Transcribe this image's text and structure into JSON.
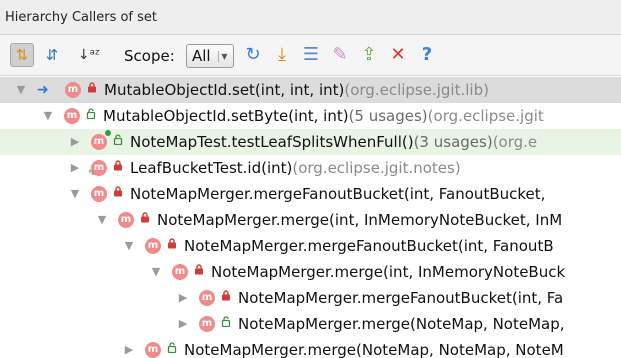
{
  "window": {
    "title": "Hierarchy Callers of set"
  },
  "toolbar": {
    "scope_label": "Scope:",
    "scope_value": "All",
    "buttons": [
      {
        "name": "caller-hierarchy-button",
        "icon": "caller-hierarchy-icon",
        "glyph": "⇅",
        "color": "#d88f1c",
        "pressed": true
      },
      {
        "name": "callee-hierarchy-button",
        "icon": "callee-hierarchy-icon",
        "glyph": "⇵",
        "color": "#3a6fc4",
        "pressed": false
      },
      {
        "name": "sort-alpha-button",
        "icon": "sort-alphabetically-icon",
        "glyph": "↓ᵃᶻ",
        "color": "#333333",
        "pressed": false
      }
    ],
    "actions": [
      {
        "name": "refresh-button",
        "icon": "refresh-icon",
        "glyph": "↻",
        "color": "#3d7fd6"
      },
      {
        "name": "expand-all-button",
        "icon": "expand-all-icon",
        "glyph": "⤓",
        "color": "#d58a1d"
      },
      {
        "name": "collapse-all-button",
        "icon": "collapse-all-icon",
        "glyph": "⇞",
        "color": "#5c8bc7"
      },
      {
        "name": "pin-button",
        "icon": "pin-icon",
        "glyph": "✎",
        "color": "#c98ccd"
      },
      {
        "name": "export-button",
        "icon": "export-icon",
        "glyph": "⇪",
        "color": "#6aa84f"
      },
      {
        "name": "close-button",
        "icon": "close-icon",
        "glyph": "✕",
        "color": "#d9362f"
      },
      {
        "name": "help-button",
        "icon": "help-icon",
        "glyph": "?",
        "color": "#3a83d8"
      }
    ]
  },
  "tree": {
    "rows": [
      {
        "name": "MutableObjectId.set(int, int, int)",
        "usages": "",
        "pkg": " (org.eclipse.jgit.lib)",
        "access": "private",
        "arrow": "▼",
        "selected": true,
        "root": true,
        "level": 0
      },
      {
        "name": "MutableObjectId.setByte(int, int)",
        "usages": "(5 usages)",
        "pkg": " (org.eclipse.jgit",
        "access": "pkg",
        "arrow": "▼",
        "level": 1
      },
      {
        "name": "NoteMapTest.testLeafSplitsWhenFull()",
        "usages": "(3 usages)",
        "pkg": " (org.e",
        "access": "pkg",
        "arrow": "▶",
        "changed": true,
        "test": true,
        "level": 2
      },
      {
        "name": "LeafBucketTest.id(int)",
        "usages": "",
        "pkg": " (org.eclipse.jgit.notes)",
        "access": "private",
        "arrow": "▶",
        "test": true,
        "level": 2
      },
      {
        "name": "NoteMapMerger.mergeFanoutBucket(int, FanoutBucket,",
        "usages": "",
        "pkg": "",
        "access": "private",
        "arrow": "▼",
        "level": 2
      },
      {
        "name": "NoteMapMerger.merge(int, InMemoryNoteBucket, InM",
        "usages": "",
        "pkg": "",
        "access": "private",
        "arrow": "▼",
        "level": 3
      },
      {
        "name": "NoteMapMerger.mergeFanoutBucket(int, FanoutB",
        "usages": "",
        "pkg": "",
        "access": "private",
        "arrow": "▼",
        "level": 4
      },
      {
        "name": "NoteMapMerger.merge(int, InMemoryNoteBuck",
        "usages": "",
        "pkg": "",
        "access": "private",
        "arrow": "▼",
        "level": 5
      },
      {
        "name": "NoteMapMerger.mergeFanoutBucket(int, Fa",
        "usages": "",
        "pkg": "",
        "access": "private",
        "arrow": "▶",
        "level": 6
      },
      {
        "name": "NoteMapMerger.merge(NoteMap, NoteMap,",
        "usages": "",
        "pkg": "",
        "access": "pkg",
        "arrow": "▶",
        "level": 6
      },
      {
        "name": "NoteMapMerger.merge(NoteMap, NoteMap, NoteM",
        "usages": "",
        "pkg": "",
        "access": "pkg",
        "arrow": "▶",
        "level": 4
      }
    ]
  }
}
